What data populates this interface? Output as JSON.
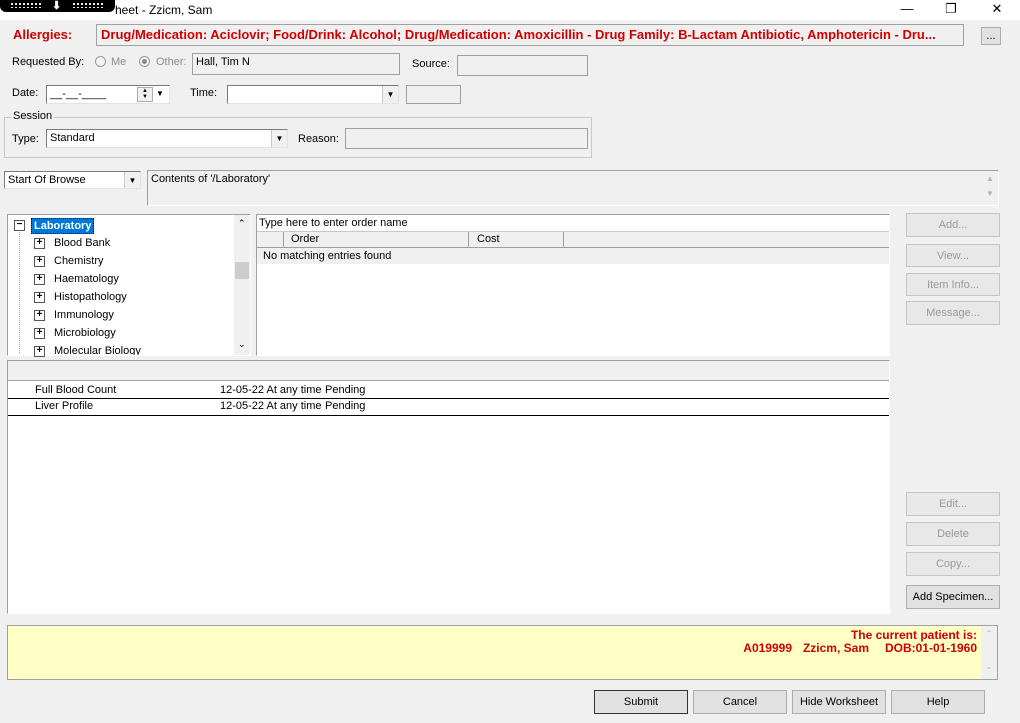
{
  "window": {
    "title": "heet - Zzicm, Sam",
    "controls": {
      "minimize": "—",
      "restore": "❐",
      "close": "✕"
    }
  },
  "allergies": {
    "label": "Allergies:",
    "text": "Drug/Medication: Aciclovir; Food/Drink: Alcohol; Drug/Medication: Amoxicillin - Drug Family: B-Lactam Antibiotic, Amphotericin - Dru...",
    "more_button": "..."
  },
  "requested_by": {
    "label": "Requested By:",
    "option_me": "Me",
    "option_other": "Other:",
    "value": "Hall, Tim N"
  },
  "source": {
    "label": "Source:",
    "value": ""
  },
  "date": {
    "label": "Date:",
    "value": "__-__-____"
  },
  "time": {
    "label": "Time:",
    "value": ""
  },
  "session": {
    "group_label": "Session",
    "type_label": "Type:",
    "type_value": "Standard",
    "reason_label": "Reason:",
    "reason_value": ""
  },
  "browse": {
    "select_value": "Start Of Browse",
    "contents": "Contents of '/Laboratory'"
  },
  "tree": {
    "root": "Laboratory",
    "items": [
      "Blood Bank",
      "Chemistry",
      "Haematology",
      "Histopathology",
      "Immunology",
      "Microbiology",
      "Molecular Biology"
    ]
  },
  "order_search": {
    "placeholder": "Type here to enter order name",
    "columns": [
      "Order",
      "Cost"
    ],
    "empty_message": "No matching entries found"
  },
  "side_buttons": {
    "add": "Add...",
    "view": "View...",
    "item_info": "Item Info...",
    "message": "Message...",
    "edit": "Edit...",
    "delete": "Delete",
    "copy": "Copy...",
    "add_specimen": "Add Specimen..."
  },
  "orders": [
    {
      "name": "Full Blood Count",
      "when": "12-05-22 At any time",
      "status": "Pending"
    },
    {
      "name": "Liver Profile",
      "when": "12-05-22 At any time",
      "status": "Pending"
    }
  ],
  "patient": {
    "heading": "The current patient is:",
    "id": "A019999",
    "name": "Zzicm, Sam",
    "dob": "DOB:01-01-1960"
  },
  "footer_buttons": {
    "submit": "Submit",
    "cancel": "Cancel",
    "hide_worksheet": "Hide Worksheet",
    "help": "Help"
  }
}
